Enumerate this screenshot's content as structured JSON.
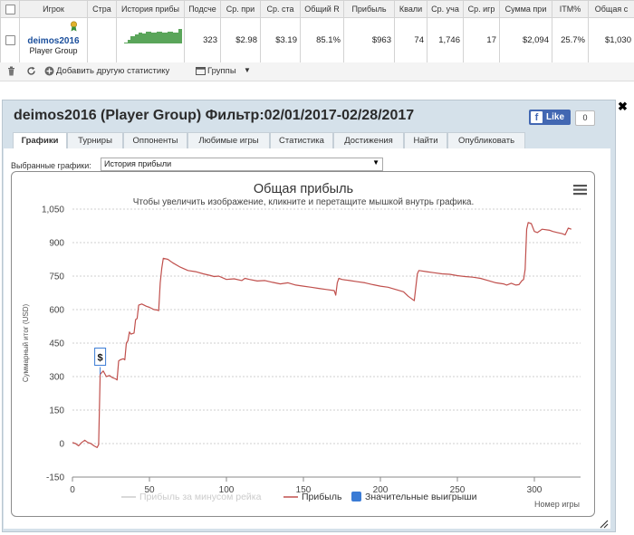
{
  "table": {
    "headers": [
      "Игрок",
      "Стра",
      "История прибы",
      "Подсче",
      "Ср. при",
      "Ср. ста",
      "Общий R",
      "Прибыль",
      "Квали",
      "Ср. уча",
      "Ср. игр",
      "Сумма при",
      "ITM%",
      "Общая с"
    ],
    "row": {
      "player_name": "deimos2016",
      "player_group": "Player Group",
      "count": "323",
      "avg_profit": "$2.98",
      "avg_stake": "$3.19",
      "total_roi": "85.1%",
      "profit": "$963",
      "qualifier": "74",
      "avg_entrants": "1,746",
      "avg_games": "17",
      "total_prize": "$2,094",
      "itm": "25.7%",
      "total_stake": "$1,030"
    }
  },
  "toolbar": {
    "add_stat_label": "Добавить другую статистику",
    "groups_label": "Группы"
  },
  "panel": {
    "title": "deimos2016 (Player Group) Фильтр:02/01/2017-02/28/2017",
    "fb_like": "Like",
    "fb_count": "0",
    "tabs": [
      "Графики",
      "Турниры",
      "Оппоненты",
      "Любимые игры",
      "Статистика",
      "Достижения",
      "Найти",
      "Опубликовать"
    ],
    "selected_label": "Выбранные графики:",
    "selected_value": "История прибыли"
  },
  "chart_data": {
    "type": "line",
    "title": "Общая прибыль",
    "subtitle": "Чтобы увеличить изображение, кликните и перетащите мышкой внутрь графика.",
    "xlabel": "Номер игры",
    "ylabel": "Суммарный итог (USD)",
    "xlim": [
      0,
      330
    ],
    "ylim": [
      -150,
      1050
    ],
    "x_ticks": [
      0,
      50,
      100,
      150,
      200,
      250,
      300
    ],
    "y_ticks": [
      -150,
      0,
      150,
      300,
      450,
      600,
      750,
      900,
      1050
    ],
    "y_tick_labels": [
      "-150",
      "0",
      "150",
      "300",
      "450",
      "600",
      "750",
      "900",
      "1,050"
    ],
    "grid": true,
    "legend": [
      "Прибыль за минусом рейка",
      "Прибыль",
      "Значительные выигрыши"
    ],
    "series": [
      {
        "name": "Прибыль",
        "color": "#c0504d",
        "points": [
          [
            0,
            5
          ],
          [
            2,
            0
          ],
          [
            4,
            -10
          ],
          [
            6,
            5
          ],
          [
            8,
            15
          ],
          [
            10,
            5
          ],
          [
            12,
            0
          ],
          [
            14,
            -10
          ],
          [
            16,
            -18
          ],
          [
            17,
            -5
          ],
          [
            18,
            310
          ],
          [
            20,
            325
          ],
          [
            22,
            300
          ],
          [
            24,
            305
          ],
          [
            26,
            295
          ],
          [
            28,
            290
          ],
          [
            29,
            285
          ],
          [
            30,
            370
          ],
          [
            31,
            375
          ],
          [
            33,
            380
          ],
          [
            34,
            375
          ],
          [
            35,
            450
          ],
          [
            36,
            460
          ],
          [
            37,
            500
          ],
          [
            38,
            490
          ],
          [
            40,
            495
          ],
          [
            41,
            555
          ],
          [
            42,
            560
          ],
          [
            43,
            620
          ],
          [
            45,
            625
          ],
          [
            48,
            615
          ],
          [
            50,
            610
          ],
          [
            53,
            600
          ],
          [
            55,
            598
          ],
          [
            56,
            595
          ],
          [
            57,
            720
          ],
          [
            58,
            785
          ],
          [
            59,
            830
          ],
          [
            62,
            825
          ],
          [
            65,
            810
          ],
          [
            70,
            790
          ],
          [
            75,
            775
          ],
          [
            80,
            770
          ],
          [
            85,
            760
          ],
          [
            90,
            752
          ],
          [
            92,
            748
          ],
          [
            95,
            750
          ],
          [
            100,
            735
          ],
          [
            105,
            738
          ],
          [
            110,
            730
          ],
          [
            112,
            740
          ],
          [
            115,
            735
          ],
          [
            120,
            728
          ],
          [
            125,
            730
          ],
          [
            130,
            722
          ],
          [
            135,
            715
          ],
          [
            140,
            720
          ],
          [
            145,
            710
          ],
          [
            150,
            705
          ],
          [
            155,
            700
          ],
          [
            160,
            695
          ],
          [
            165,
            690
          ],
          [
            170,
            685
          ],
          [
            171,
            665
          ],
          [
            172,
            720
          ],
          [
            173,
            740
          ],
          [
            175,
            735
          ],
          [
            180,
            730
          ],
          [
            185,
            725
          ],
          [
            190,
            720
          ],
          [
            195,
            712
          ],
          [
            200,
            705
          ],
          [
            205,
            700
          ],
          [
            210,
            690
          ],
          [
            215,
            680
          ],
          [
            218,
            660
          ],
          [
            220,
            650
          ],
          [
            222,
            640
          ],
          [
            224,
            760
          ],
          [
            225,
            775
          ],
          [
            230,
            770
          ],
          [
            235,
            765
          ],
          [
            240,
            760
          ],
          [
            245,
            758
          ],
          [
            250,
            752
          ],
          [
            255,
            748
          ],
          [
            260,
            745
          ],
          [
            265,
            740
          ],
          [
            270,
            730
          ],
          [
            275,
            720
          ],
          [
            280,
            715
          ],
          [
            282,
            710
          ],
          [
            285,
            718
          ],
          [
            288,
            710
          ],
          [
            290,
            712
          ],
          [
            292,
            730
          ],
          [
            293,
            735
          ],
          [
            294,
            780
          ],
          [
            295,
            960
          ],
          [
            296,
            990
          ],
          [
            298,
            985
          ],
          [
            300,
            950
          ],
          [
            302,
            945
          ],
          [
            305,
            960
          ],
          [
            310,
            955
          ],
          [
            312,
            950
          ],
          [
            315,
            945
          ],
          [
            318,
            940
          ],
          [
            320,
            935
          ],
          [
            322,
            965
          ],
          [
            324,
            960
          ]
        ]
      }
    ],
    "markers": [
      {
        "label": "$",
        "x": 18,
        "y": 310
      }
    ]
  }
}
